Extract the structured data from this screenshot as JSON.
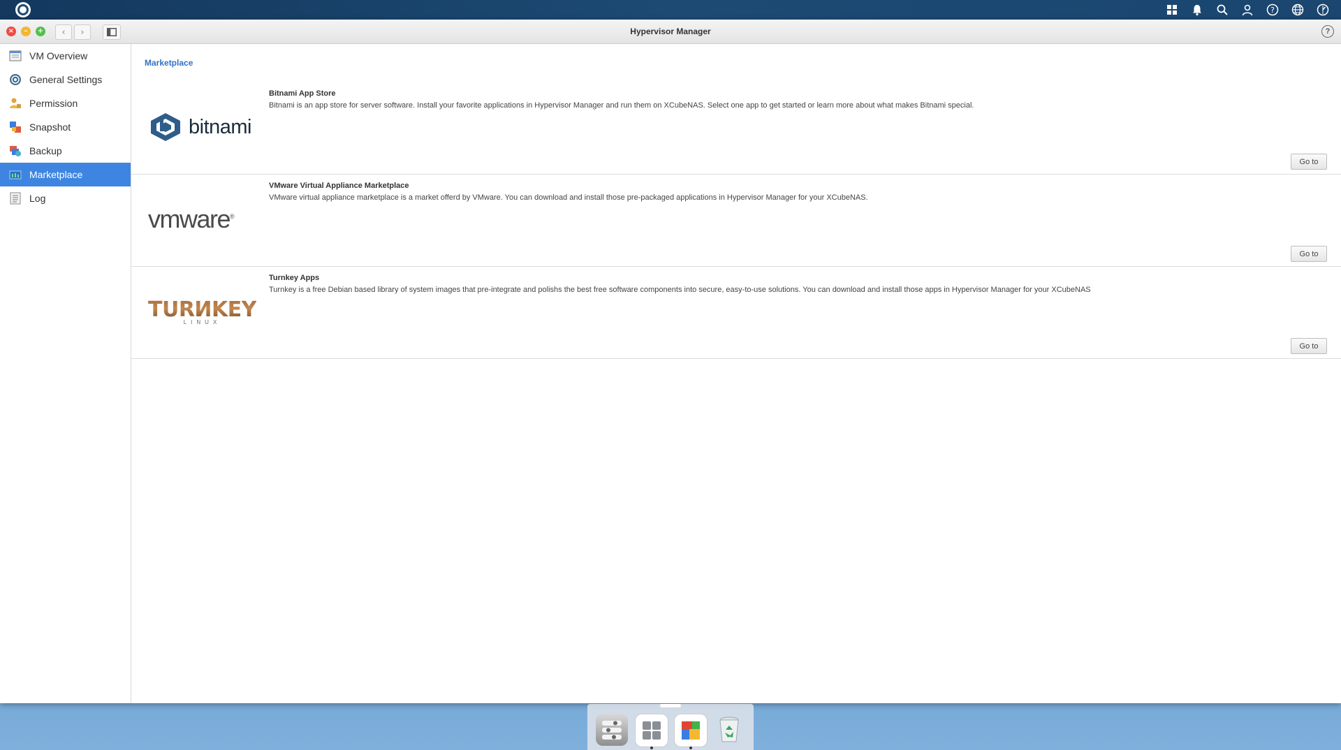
{
  "window": {
    "title": "Hypervisor Manager",
    "help_label": "?",
    "close_glyph": "×",
    "min_glyph": "–",
    "max_glyph": "+"
  },
  "topbar": {
    "icons": [
      "apps-icon",
      "bell-icon",
      "search-icon",
      "user-icon",
      "help-icon",
      "globe-icon",
      "dashboard-icon"
    ]
  },
  "sidebar": {
    "items": [
      {
        "label": "VM Overview",
        "icon": "vm-overview-icon"
      },
      {
        "label": "General Settings",
        "icon": "settings-icon"
      },
      {
        "label": "Permission",
        "icon": "permission-icon"
      },
      {
        "label": "Snapshot",
        "icon": "snapshot-icon"
      },
      {
        "label": "Backup",
        "icon": "backup-icon"
      },
      {
        "label": "Marketplace",
        "icon": "marketplace-icon"
      },
      {
        "label": "Log",
        "icon": "log-icon"
      }
    ],
    "active_index": 5
  },
  "main": {
    "breadcrumb": "Marketplace",
    "rows": [
      {
        "title": "Bitnami App Store",
        "description": "Bitnami is an app store for server software. Install your favorite applications in Hypervisor Manager and run them on XCubeNAS. Select one app to get started or learn more about what makes Bitnami special.",
        "logo_text": "bitnami",
        "button": "Go to"
      },
      {
        "title": "VMware Virtual Appliance Marketplace",
        "description": "VMware virtual appliance marketplace is a market offerd by VMware. You can download and install those pre-packaged applications in Hypervisor Manager for your XCubeNAS.",
        "logo_text": "vmware",
        "logo_mark": "®",
        "button": "Go to"
      },
      {
        "title": "Turnkey Apps",
        "description": "Turnkey is a free Debian based library of system images that pre-integrate and polishs the best free software components into secure, easy-to-use solutions. You can download and install those apps in Hypervisor Manager for your XCubeNAS",
        "logo_text": "TURИKEY",
        "logo_sub": "LINUX",
        "button": "Go to"
      }
    ]
  },
  "dock": {
    "apps": [
      "control-panel-icon",
      "app-center-icon",
      "hypervisor-manager-icon",
      "recycle-bin-icon"
    ]
  },
  "colors": {
    "accent": "#3d85e0",
    "breadcrumb": "#2f73c7",
    "topbar": "#1c4a73"
  }
}
